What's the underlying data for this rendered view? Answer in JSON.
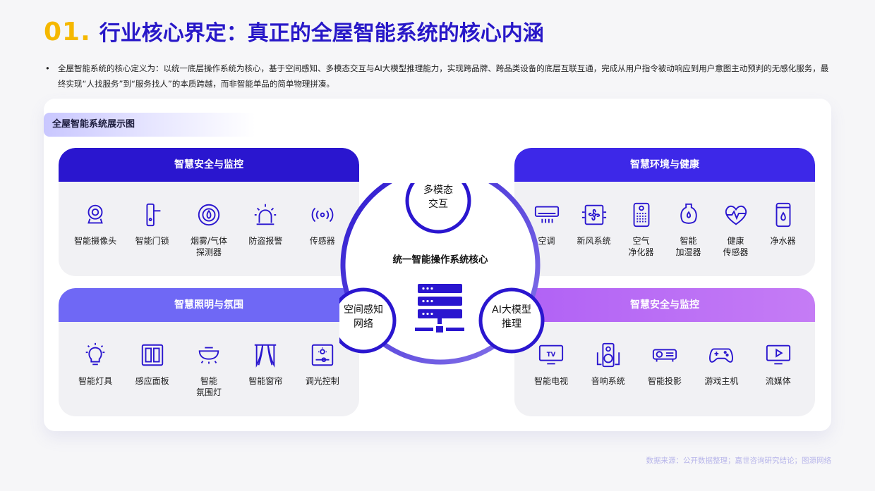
{
  "header": {
    "number": "01.",
    "title": "行业核心界定：真正的全屋智能系统的核心内涵"
  },
  "intro": {
    "bullet": "•",
    "text": "全屋智能系统的核心定义为：以统一底层操作系统为核心，基于空间感知、多模态交互与AI大模型推理能力，实现跨品牌、跨品类设备的底层互联互通，完成从用户指令被动响应到用户意图主动预判的无感化服务，最终实现“人找服务”到“服务找人”的本质跨越，而非智能单品的简单物理拼凑。"
  },
  "diagram": {
    "tag": "全屋智能系统展示图",
    "core": {
      "label": "统一智能操作系统核心",
      "top_node": "多模态\n交互",
      "left_node": "空间感知\n网络",
      "right_node": "AI大模型\n推理"
    },
    "panels": [
      {
        "title": "智慧安全与监控",
        "items": [
          {
            "icon": "camera-icon",
            "label": "智能摄像头"
          },
          {
            "icon": "door-lock-icon",
            "label": "智能门锁"
          },
          {
            "icon": "smoke-detector-icon",
            "label": "烟雾/气体\n探测器"
          },
          {
            "icon": "alarm-siren-icon",
            "label": "防盗报警"
          },
          {
            "icon": "sensor-wave-icon",
            "label": "传感器"
          }
        ]
      },
      {
        "title": "智慧照明与氛围",
        "items": [
          {
            "icon": "bulb-icon",
            "label": "智能灯具"
          },
          {
            "icon": "panel-switch-icon",
            "label": "感应面板"
          },
          {
            "icon": "ceiling-light-icon",
            "label": "智能\n氛围灯"
          },
          {
            "icon": "curtain-icon",
            "label": "智能窗帘"
          },
          {
            "icon": "dimmer-icon",
            "label": "调光控制"
          }
        ]
      },
      {
        "title": "智慧环境与健康",
        "items": [
          {
            "icon": "air-conditioner-icon",
            "label": "空调"
          },
          {
            "icon": "fan-icon",
            "label": "新风系统"
          },
          {
            "icon": "air-purifier-icon",
            "label": "空气\n净化器"
          },
          {
            "icon": "humidifier-icon",
            "label": "智能\n加湿器"
          },
          {
            "icon": "heart-sensor-icon",
            "label": "健康\n传感器"
          },
          {
            "icon": "water-purifier-icon",
            "label": "净水器"
          }
        ]
      },
      {
        "title": "智慧安全与监控",
        "items": [
          {
            "icon": "tv-icon",
            "label": "智能电视"
          },
          {
            "icon": "speaker-icon",
            "label": "音响系统"
          },
          {
            "icon": "projector-icon",
            "label": "智能投影"
          },
          {
            "icon": "gamepad-icon",
            "label": "游戏主机"
          },
          {
            "icon": "play-icon",
            "label": "流媒体"
          }
        ]
      }
    ]
  },
  "source": "数据来源：公开数据整理；嘉世咨询研究结论；图源网络",
  "colors": {
    "accent_yellow": "#f5b800",
    "primary_blue": "#2818c8",
    "panel_blue": "#2a16cf",
    "panel_violet": "#6f68f5",
    "panel_purple": "#b061f5"
  }
}
